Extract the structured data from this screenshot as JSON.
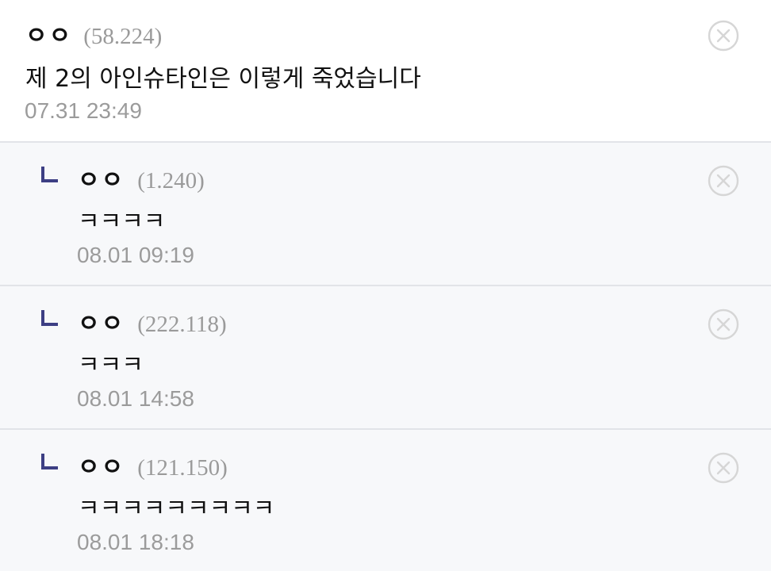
{
  "icons": {
    "reply": "reply-arrow-icon",
    "delete": "close-circle-icon"
  },
  "colors": {
    "reply_icon": "#3d3f84",
    "meta_text": "#9a9a9a",
    "reply_bg": "#f7f8fa",
    "divider": "#e2e4e8",
    "delete_icon": "#d6d6d6"
  },
  "main_comment": {
    "nickname": "ㅇㅇ",
    "ip": "(58.224)",
    "content": "제 2의 아인슈타인은 이렇게 죽었습니다",
    "date": "07.31 23:49"
  },
  "replies": [
    {
      "nickname": "ㅇㅇ",
      "ip": "(1.240)",
      "content": "ㅋㅋㅋㅋ",
      "date": "08.01 09:19"
    },
    {
      "nickname": "ㅇㅇ",
      "ip": "(222.118)",
      "content": "ㅋㅋㅋ",
      "date": "08.01 14:58"
    },
    {
      "nickname": "ㅇㅇ",
      "ip": "(121.150)",
      "content": "ㅋㅋㅋㅋㅋㅋㅋㅋㅋ",
      "date": "08.01 18:18"
    }
  ]
}
